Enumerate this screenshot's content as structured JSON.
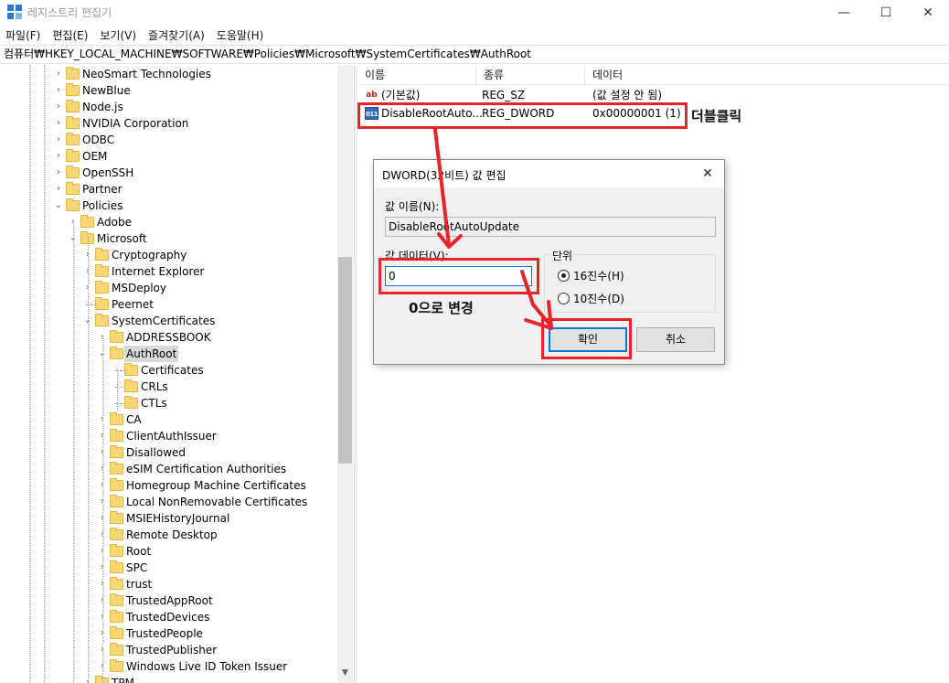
{
  "window": {
    "title": "레지스트리 편집기",
    "minimize_glyph": "—",
    "maximize_glyph": "☐",
    "close_glyph": "✕"
  },
  "menu": [
    "파일(F)",
    "편집(E)",
    "보기(V)",
    "즐겨찾기(A)",
    "도움말(H)"
  ],
  "address": "컴퓨터₩HKEY_LOCAL_MACHINE₩SOFTWARE₩Policies₩Microsoft₩SystemCertificates₩AuthRoot",
  "tree": {
    "items": [
      {
        "label": "NeoSmart Technologies",
        "level": 0,
        "arrow": "›"
      },
      {
        "label": "NewBlue",
        "level": 0,
        "arrow": "›"
      },
      {
        "label": "Node.js",
        "level": 0,
        "arrow": "›"
      },
      {
        "label": "NVIDIA Corporation",
        "level": 0,
        "arrow": "›"
      },
      {
        "label": "ODBC",
        "level": 0,
        "arrow": "›"
      },
      {
        "label": "OEM",
        "level": 0,
        "arrow": "›"
      },
      {
        "label": "OpenSSH",
        "level": 0,
        "arrow": "›"
      },
      {
        "label": "Partner",
        "level": 0,
        "arrow": "›"
      },
      {
        "label": "Policies",
        "level": 0,
        "arrow": "⌄"
      },
      {
        "label": "Adobe",
        "level": 1,
        "arrow": "›"
      },
      {
        "label": "Microsoft",
        "level": 1,
        "arrow": "⌄"
      },
      {
        "label": "Cryptography",
        "level": 2,
        "arrow": "›"
      },
      {
        "label": "Internet Explorer",
        "level": 2,
        "arrow": "›"
      },
      {
        "label": "MSDeploy",
        "level": 2,
        "arrow": "›"
      },
      {
        "label": "Peernet",
        "level": 2,
        "arrow": ""
      },
      {
        "label": "SystemCertificates",
        "level": 2,
        "arrow": "⌄"
      },
      {
        "label": "ADDRESSBOOK",
        "level": 3,
        "arrow": "›"
      },
      {
        "label": "AuthRoot",
        "level": 3,
        "arrow": "⌄",
        "selected": true
      },
      {
        "label": "Certificates",
        "level": 4,
        "arrow": ""
      },
      {
        "label": "CRLs",
        "level": 4,
        "arrow": ""
      },
      {
        "label": "CTLs",
        "level": 4,
        "arrow": ""
      },
      {
        "label": "CA",
        "level": 3,
        "arrow": "›"
      },
      {
        "label": "ClientAuthIssuer",
        "level": 3,
        "arrow": "›"
      },
      {
        "label": "Disallowed",
        "level": 3,
        "arrow": "›"
      },
      {
        "label": "eSIM Certification Authorities",
        "level": 3,
        "arrow": "›"
      },
      {
        "label": "Homegroup Machine Certificates",
        "level": 3,
        "arrow": "›"
      },
      {
        "label": "Local NonRemovable Certificates",
        "level": 3,
        "arrow": "›"
      },
      {
        "label": "MSIEHistoryJournal",
        "level": 3,
        "arrow": "›"
      },
      {
        "label": "Remote Desktop",
        "level": 3,
        "arrow": "›"
      },
      {
        "label": "Root",
        "level": 3,
        "arrow": "›"
      },
      {
        "label": "SPC",
        "level": 3,
        "arrow": "›"
      },
      {
        "label": "trust",
        "level": 3,
        "arrow": "›"
      },
      {
        "label": "TrustedAppRoot",
        "level": 3,
        "arrow": "›"
      },
      {
        "label": "TrustedDevices",
        "level": 3,
        "arrow": "›"
      },
      {
        "label": "TrustedPeople",
        "level": 3,
        "arrow": "›"
      },
      {
        "label": "TrustedPublisher",
        "level": 3,
        "arrow": "›"
      },
      {
        "label": "Windows Live ID Token Issuer",
        "level": 3,
        "arrow": "›"
      },
      {
        "label": "TPM",
        "level": 2,
        "arrow": "›"
      }
    ]
  },
  "list": {
    "columns": [
      "이름",
      "종류",
      "데이터"
    ],
    "rows": [
      {
        "icon": "ab",
        "name": "(기본값)",
        "type": "REG_SZ",
        "data": "(값 설정 안 됨)"
      },
      {
        "icon": "bin",
        "name": "DisableRootAuto...",
        "type": "REG_DWORD",
        "data": "0x00000001 (1)"
      }
    ],
    "icon_text": {
      "ab": "ab",
      "bin": "011"
    }
  },
  "dialog": {
    "title": "DWORD(32비트) 값 편집",
    "close_glyph": "✕",
    "name_label": "값 이름(N):",
    "name_value": "DisableRootAutoUpdate",
    "data_label": "값 데이터(V):",
    "data_value": "0",
    "base_label": "단위",
    "radio_hex": "16진수(H)",
    "radio_dec": "10진수(D)",
    "ok": "확인",
    "cancel": "취소"
  },
  "annotations": {
    "double_click": "더블클릭",
    "change_to_zero": "0으로 변경"
  },
  "colors": {
    "annotation_red": "#e8232a",
    "focus_blue": "#0078d7",
    "folder_yellow": "#f8d775"
  }
}
